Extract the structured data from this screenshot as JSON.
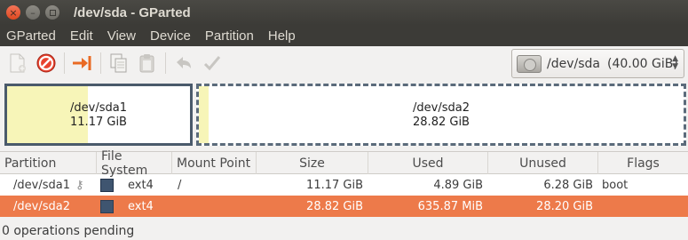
{
  "window": {
    "title": "/dev/sda - GParted"
  },
  "menu": [
    "GParted",
    "Edit",
    "View",
    "Device",
    "Partition",
    "Help"
  ],
  "toolbar": {
    "device": "/dev/sda",
    "device_size": "(40.00 GiB)",
    "icons": [
      "new-partition-icon",
      "delete-icon",
      "resize-move-icon",
      "copy-icon",
      "paste-icon",
      "undo-icon",
      "apply-icon",
      "disk-icon"
    ]
  },
  "partition_map": [
    {
      "name": "/dev/sda1",
      "size": "11.17 GiB",
      "used_fraction": 0.44
    },
    {
      "name": "/dev/sda2",
      "size": "28.82 GiB",
      "used_fraction": 0.02
    }
  ],
  "table": {
    "columns": [
      "Partition",
      "File System",
      "Mount Point",
      "Size",
      "Used",
      "Unused",
      "Flags"
    ],
    "rows": [
      {
        "partition": "/dev/sda1",
        "filesystem": "ext4",
        "mount": "/",
        "size": "11.17 GiB",
        "used": "4.89 GiB",
        "unused": "6.28 GiB",
        "flags": "boot",
        "selected": false
      },
      {
        "partition": "/dev/sda2",
        "filesystem": "ext4",
        "mount": "",
        "size": "28.82 GiB",
        "used": "635.87 MiB",
        "unused": "28.20 GiB",
        "flags": "",
        "selected": true
      }
    ]
  },
  "status": {
    "text": "0 operations pending"
  },
  "colors": {
    "selected_row": "#ed7a4a",
    "ext4": "#3f5570",
    "used_fill": "#f7f5b8"
  }
}
